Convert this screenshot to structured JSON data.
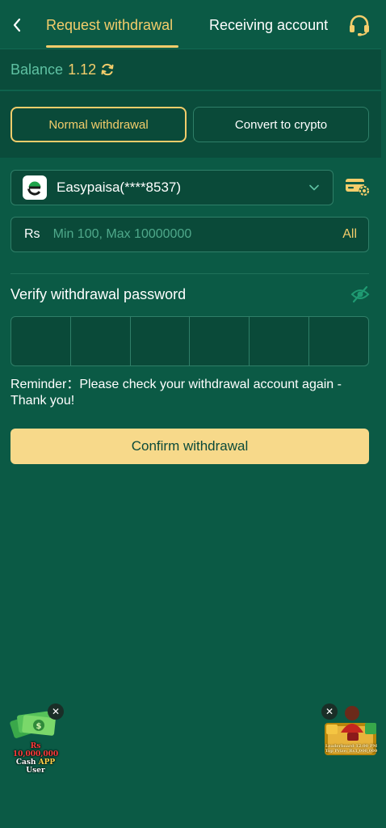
{
  "header": {
    "back_icon": "chevron-left-icon",
    "tab_active": "Request withdrawal",
    "tab_inactive": "Receiving account",
    "support_icon": "headset-icon"
  },
  "balance": {
    "label": "Balance",
    "value": "1.12",
    "refresh_icon": "refresh-icon"
  },
  "withdraw_types": {
    "normal": "Normal withdrawal",
    "crypto": "Convert to crypto",
    "selected": "Normal withdrawal"
  },
  "account": {
    "selected": "Easypaisa(****8537)",
    "logo_icon": "easypaisa-logo-icon",
    "settings_icon": "card-settings-icon"
  },
  "amount": {
    "currency": "Rs",
    "placeholder": "Min 100, Max 10000000",
    "value": "",
    "all_label": "All"
  },
  "password": {
    "label": "Verify withdrawal password",
    "eye_icon": "eye-off-icon",
    "digits": 6
  },
  "reminder": "Reminder：Please check your withdrawal account again - Thank you!",
  "confirm_label": "Confirm withdrawal",
  "promos": {
    "left": {
      "line1": "Rs 10,000,000",
      "line2a": "Cash",
      "line2b": "APP",
      "line2c": "User"
    },
    "right": {
      "line1": "Leaderboard-12:00 PM",
      "line2": "Top Prize: Rs1,000,000"
    },
    "close_glyph": "✕"
  },
  "colors": {
    "background": "#0b5a45",
    "panel": "#0a4c3b",
    "accent": "#f3cd6b",
    "confirm_bg": "#f7d98a",
    "muted_text": "#5fc2a3"
  }
}
